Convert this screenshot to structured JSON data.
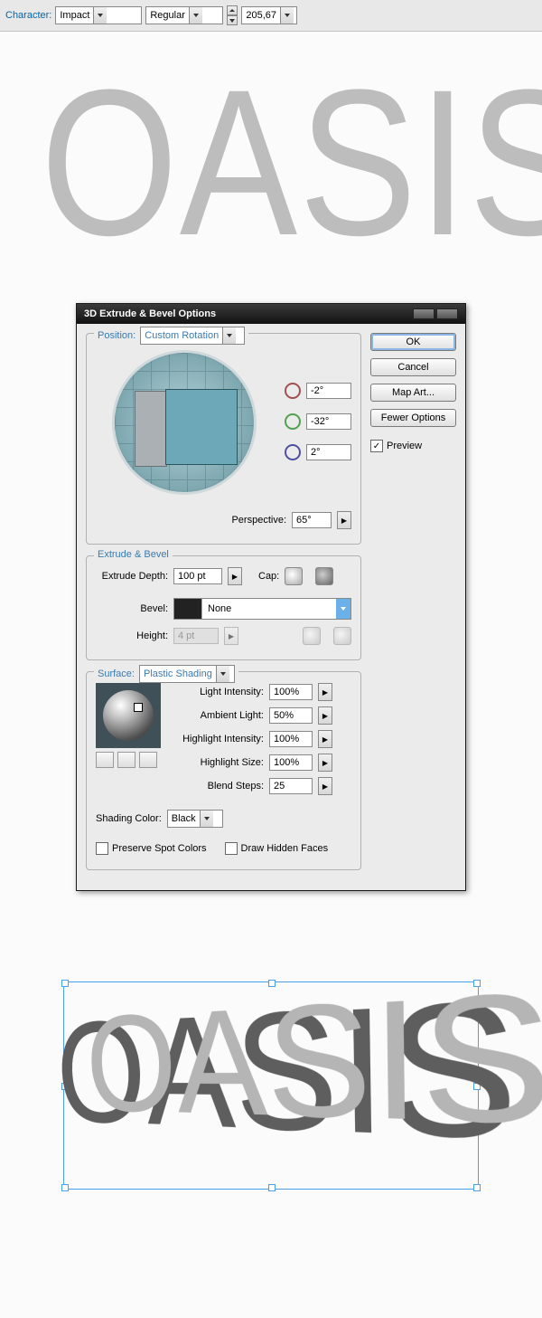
{
  "character_bar": {
    "label": "Character:",
    "font": "Impact",
    "style": "Regular",
    "size": "205,67"
  },
  "big_text": "OASIS",
  "dialog": {
    "title": "3D Extrude & Bevel Options",
    "buttons": {
      "ok": "OK",
      "cancel": "Cancel",
      "map_art": "Map Art...",
      "fewer_options": "Fewer Options"
    },
    "preview_label": "Preview",
    "position": {
      "label": "Position:",
      "value": "Custom Rotation",
      "rot_x": "-2°",
      "rot_y": "-32°",
      "rot_z": "2°",
      "perspective_label": "Perspective:",
      "perspective": "65°"
    },
    "extrude": {
      "title": "Extrude & Bevel",
      "depth_label": "Extrude Depth:",
      "depth": "100 pt",
      "cap_label": "Cap:",
      "bevel_label": "Bevel:",
      "bevel": "None",
      "height_label": "Height:",
      "height": "4 pt"
    },
    "surface": {
      "title": "Surface:",
      "value": "Plastic Shading",
      "light_intensity_label": "Light Intensity:",
      "light_intensity": "100%",
      "ambient_label": "Ambient Light:",
      "ambient": "50%",
      "highlight_intensity_label": "Highlight Intensity:",
      "highlight_intensity": "100%",
      "highlight_size_label": "Highlight Size:",
      "highlight_size": "100%",
      "blend_steps_label": "Blend Steps:",
      "blend_steps": "25",
      "shading_color_label": "Shading Color:",
      "shading_color": "Black",
      "preserve_spot": "Preserve Spot Colors",
      "draw_hidden": "Draw Hidden Faces"
    }
  },
  "art3d_text": "OASIS"
}
